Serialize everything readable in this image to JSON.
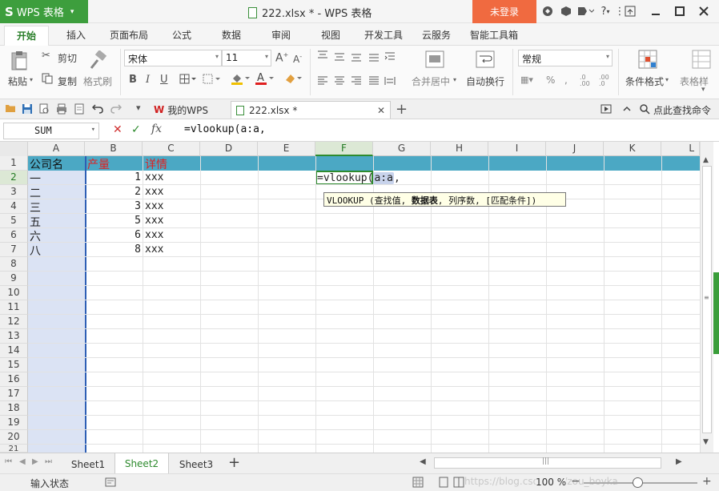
{
  "app": {
    "logo": "S",
    "name": "WPS 表格",
    "menu_arrow": "▾"
  },
  "window": {
    "title": "222.xlsx * - WPS 表格",
    "login": "未登录"
  },
  "menu": {
    "tabs": [
      "开始",
      "插入",
      "页面布局",
      "公式",
      "数据",
      "审阅",
      "视图",
      "开发工具",
      "云服务",
      "智能工具箱"
    ]
  },
  "ribbon": {
    "paste": "粘贴",
    "cut": "剪切",
    "copy": "复制",
    "format_painter": "格式刷",
    "font_name": "宋体",
    "font_size": "11",
    "merge_center": "合并居中",
    "wrap_text": "自动换行",
    "number_format": "常规",
    "conditional_format": "条件格式",
    "table_style": "表格样"
  },
  "docbar": {
    "my_wps": "我的WPS",
    "file_tab": "222.xlsx *",
    "find_cmd": "点此查找命令"
  },
  "formula": {
    "name_box": "SUM",
    "fx": "fx",
    "text": "=vlookup(a:a,"
  },
  "grid": {
    "columns": [
      "A",
      "B",
      "C",
      "D",
      "E",
      "F",
      "G",
      "H",
      "I",
      "J",
      "K",
      "L"
    ],
    "rows": [
      "1",
      "2",
      "3",
      "4",
      "5",
      "6",
      "7",
      "8",
      "9",
      "10",
      "11",
      "12",
      "13",
      "14",
      "15",
      "16",
      "17",
      "18",
      "19",
      "20",
      "21"
    ],
    "header_row": {
      "a": "公司名",
      "b": "产量",
      "c": "详情"
    },
    "data": [
      {
        "a": "一",
        "b": "1",
        "c": "xxx"
      },
      {
        "a": "二",
        "b": "2",
        "c": "xxx"
      },
      {
        "a": "三",
        "b": "3",
        "c": "xxx"
      },
      {
        "a": "五",
        "b": "5",
        "c": "xxx"
      },
      {
        "a": "六",
        "b": "6",
        "c": "xxx"
      },
      {
        "a": "八",
        "b": "8",
        "c": "xxx"
      }
    ],
    "editing_cell": {
      "prefix": "=vlookup(",
      "range": "a:a",
      "suffix": ","
    },
    "tooltip": {
      "pre": "VLOOKUP (查找值, ",
      "bold": "数据表",
      "post": ", 列序数, [匹配条件])"
    }
  },
  "sheets": {
    "tabs": [
      "Sheet1",
      "Sheet2",
      "Sheet3"
    ],
    "active": "Sheet2"
  },
  "status": {
    "mode": "输入状态",
    "zoom": "100 %",
    "watermark": "https://blog.csdn.net/zou_boyka"
  },
  "colors": {
    "brand_green": "#3d9e3d",
    "login_orange": "#f06a40",
    "header_teal": "#4ba8c4",
    "red_text": "#e02020",
    "selected_col": "#dbe3f4"
  }
}
